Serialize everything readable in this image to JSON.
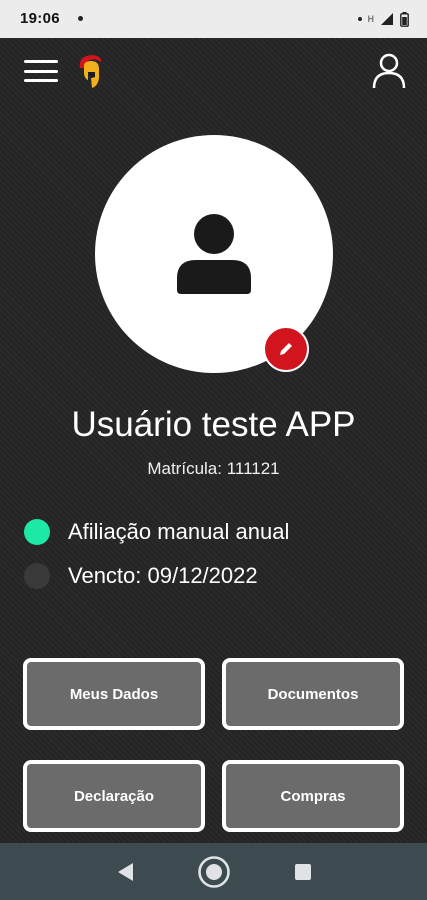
{
  "status_bar": {
    "time": "19:06",
    "network_label": "H"
  },
  "profile": {
    "name": "Usuário teste APP",
    "matricula": "Matrícula: 111121"
  },
  "status": [
    {
      "label": "Afiliação manual anual",
      "color": "#1de9a6"
    },
    {
      "label": "Vencto: 09/12/2022",
      "color": "#3a3a3a"
    }
  ],
  "buttons": {
    "meus_dados": "Meus Dados",
    "documentos": "Documentos",
    "declaracao": "Declaração",
    "compras": "Compras"
  },
  "colors": {
    "accent": "#d2141f",
    "active_status": "#1de9a6",
    "button_bg": "#6b6b6b",
    "nav_bar": "#3d4b51"
  },
  "icons": {
    "menu": "hamburger-menu-icon",
    "logo": "spartan-helmet-logo",
    "user": "user-outline-icon",
    "avatar": "person-silhouette-icon",
    "edit": "pencil-icon"
  }
}
